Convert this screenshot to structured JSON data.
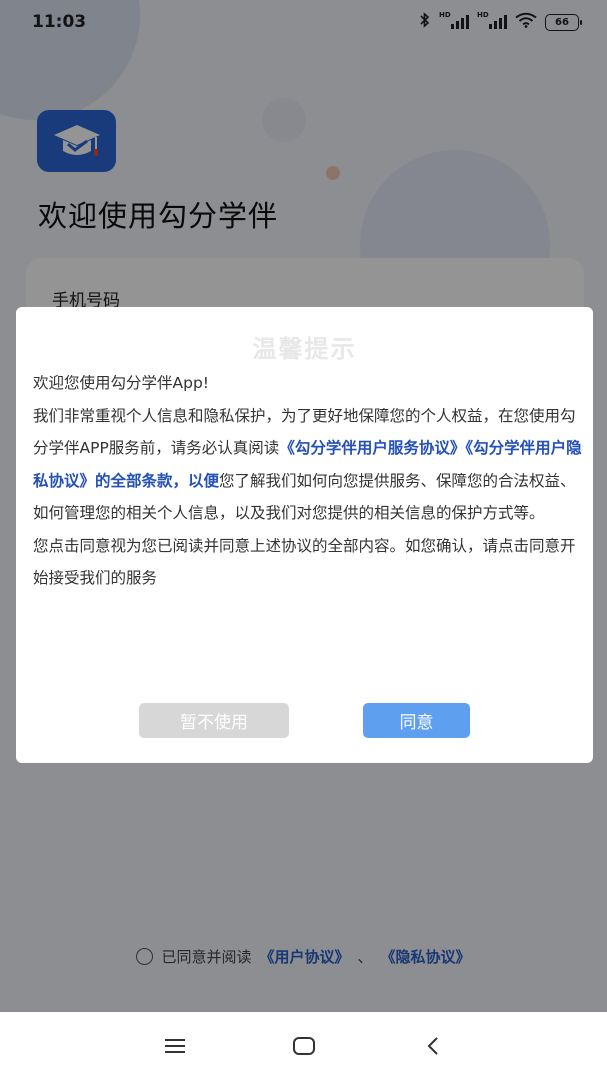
{
  "status_bar": {
    "time": "11:03",
    "network_hd_1": "HD",
    "network_hd_2": "HD",
    "battery": "66"
  },
  "app": {
    "welcome_title": "欢迎使用勾分学伴",
    "phone_label": "手机号码",
    "brand_color": "#2b66d6"
  },
  "dialog": {
    "title": "温馨提示",
    "greeting": "欢迎您使用勾分学伴App!",
    "para1_a": "我们非常重视个人信息和隐私保护，为了更好地保障您的个人权益，在您使用勾分学伴APP服务前，请务必认真阅读",
    "para1_link1": "《勾分学伴用户服务协议》",
    "para1_link2": "《勾分学伴用户隐私协议》",
    "para1_b": "的全部条款，以便",
    "para1_c": "您了解我们如何向您提供服务、保障您的合法权益、如何管理您的相关个人信息，以及我们对您提供的相关信息的保护方式等。",
    "para2": "您点击同意视为您已阅读并同意上述协议的全部内容。如您确认，请点击同意开始接受我们的服务",
    "decline_label": "暂不使用",
    "agree_label": "同意",
    "agree_color": "#5f9ff0",
    "link_color": "#2451b8"
  },
  "agreement": {
    "text": "已同意并阅读",
    "user_agreement": "《用户协议》",
    "separator": "、",
    "privacy_agreement": "《隐私协议》"
  },
  "navbar": {
    "menu_icon": "menu-icon",
    "home_icon": "home-square-icon",
    "back_icon": "back-chevron-icon"
  }
}
